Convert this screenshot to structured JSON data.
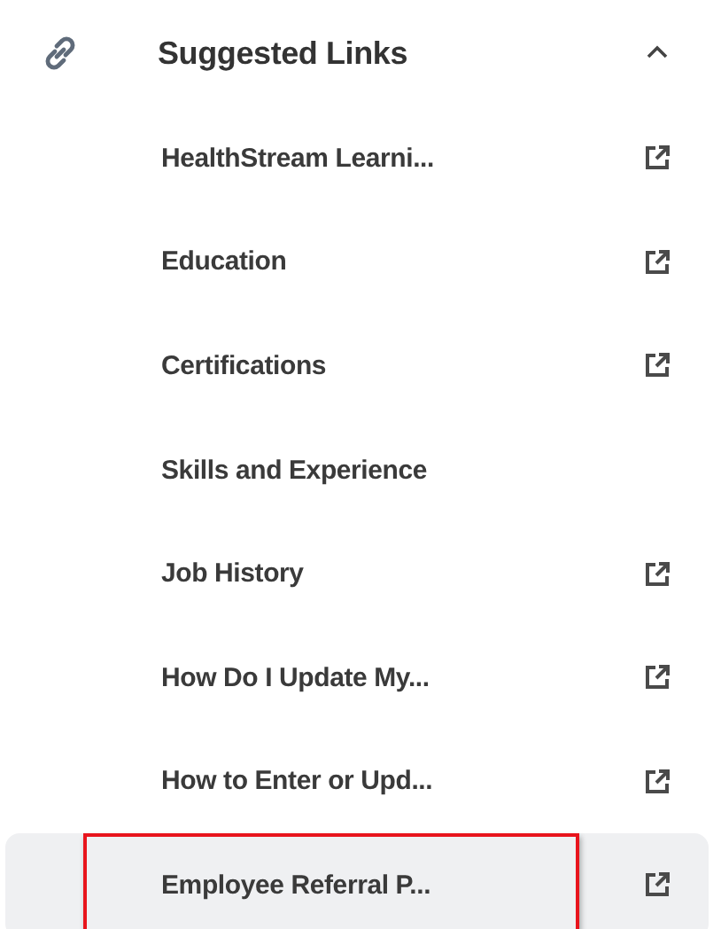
{
  "section": {
    "title": "Suggested Links",
    "expanded": true
  },
  "links": [
    {
      "label": "HealthStream Learni...",
      "external": true,
      "selected": false,
      "outlined": false
    },
    {
      "label": "Education",
      "external": true,
      "selected": false,
      "outlined": false
    },
    {
      "label": "Certifications",
      "external": true,
      "selected": false,
      "outlined": false
    },
    {
      "label": "Skills and Experience",
      "external": false,
      "selected": false,
      "outlined": false
    },
    {
      "label": "Job History",
      "external": true,
      "selected": false,
      "outlined": false
    },
    {
      "label": "How Do I Update My...",
      "external": true,
      "selected": false,
      "outlined": false
    },
    {
      "label": "How to Enter or Upd...",
      "external": true,
      "selected": false,
      "outlined": false
    },
    {
      "label": "Employee Referral P...",
      "external": true,
      "selected": true,
      "outlined": true
    }
  ]
}
